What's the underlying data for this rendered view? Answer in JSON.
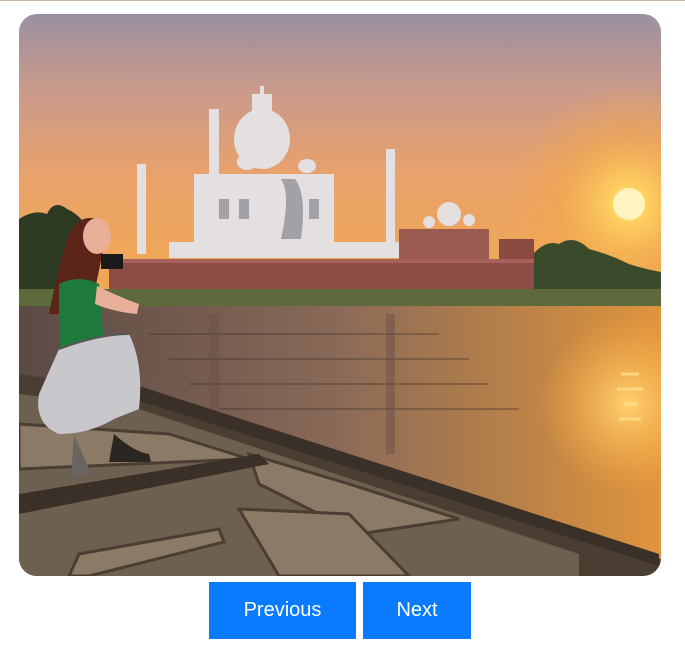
{
  "slideshow": {
    "slide_image": "taj-mahal-sunset-boat-photo",
    "controls": {
      "previous_label": "Previous",
      "next_label": "Next"
    },
    "colors": {
      "button_bg": "#0a7bff",
      "button_text": "#ffffff"
    }
  }
}
